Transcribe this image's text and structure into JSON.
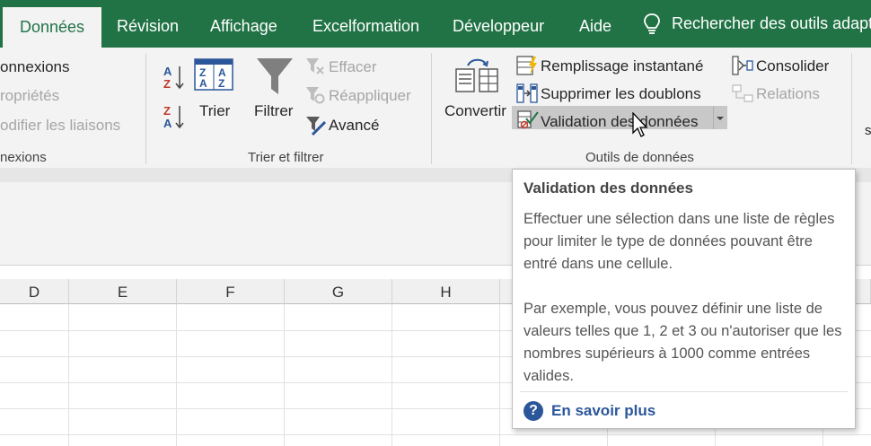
{
  "tabs": {
    "donnees": "Données",
    "revision": "Révision",
    "affichage": "Affichage",
    "excelformation": "Excelformation",
    "developpeur": "Développeur",
    "aide": "Aide",
    "search": "Rechercher des outils adapté"
  },
  "connexions": {
    "connexions": "onnexions",
    "proprietes": "ropriétés",
    "modifier": "odifier les liaisons",
    "group_label": "nexions"
  },
  "trier_filtrer": {
    "trier": "Trier",
    "filtrer": "Filtrer",
    "effacer": "Effacer",
    "reappliquer": "Réappliquer",
    "avance": "Avancé",
    "group_label": "Trier et filtrer"
  },
  "outils": {
    "convertir": "Convertir",
    "remplissage": "Remplissage instantané",
    "supprimer": "Supprimer les doublons",
    "validation": "Validation des données",
    "consolider": "Consolider",
    "relations": "Relations",
    "group_label": "Outils de données",
    "cut_label": "s"
  },
  "columns": [
    "D",
    "E",
    "F",
    "G",
    "H"
  ],
  "tooltip": {
    "title": "Validation des données",
    "para1": "Effectuer une sélection dans une liste de règles pour limiter le type de données pouvant être entré dans une cellule.",
    "para2": "Par exemple, vous pouvez définir une liste de valeurs telles que 1, 2 et 3 ou n'autoriser que les nombres supérieurs à 1000 comme entrées valides.",
    "link": "En savoir plus"
  },
  "colors": {
    "excel_green": "#217346",
    "ribbon_bg": "#f3f3f3",
    "link_blue": "#2b579a"
  }
}
